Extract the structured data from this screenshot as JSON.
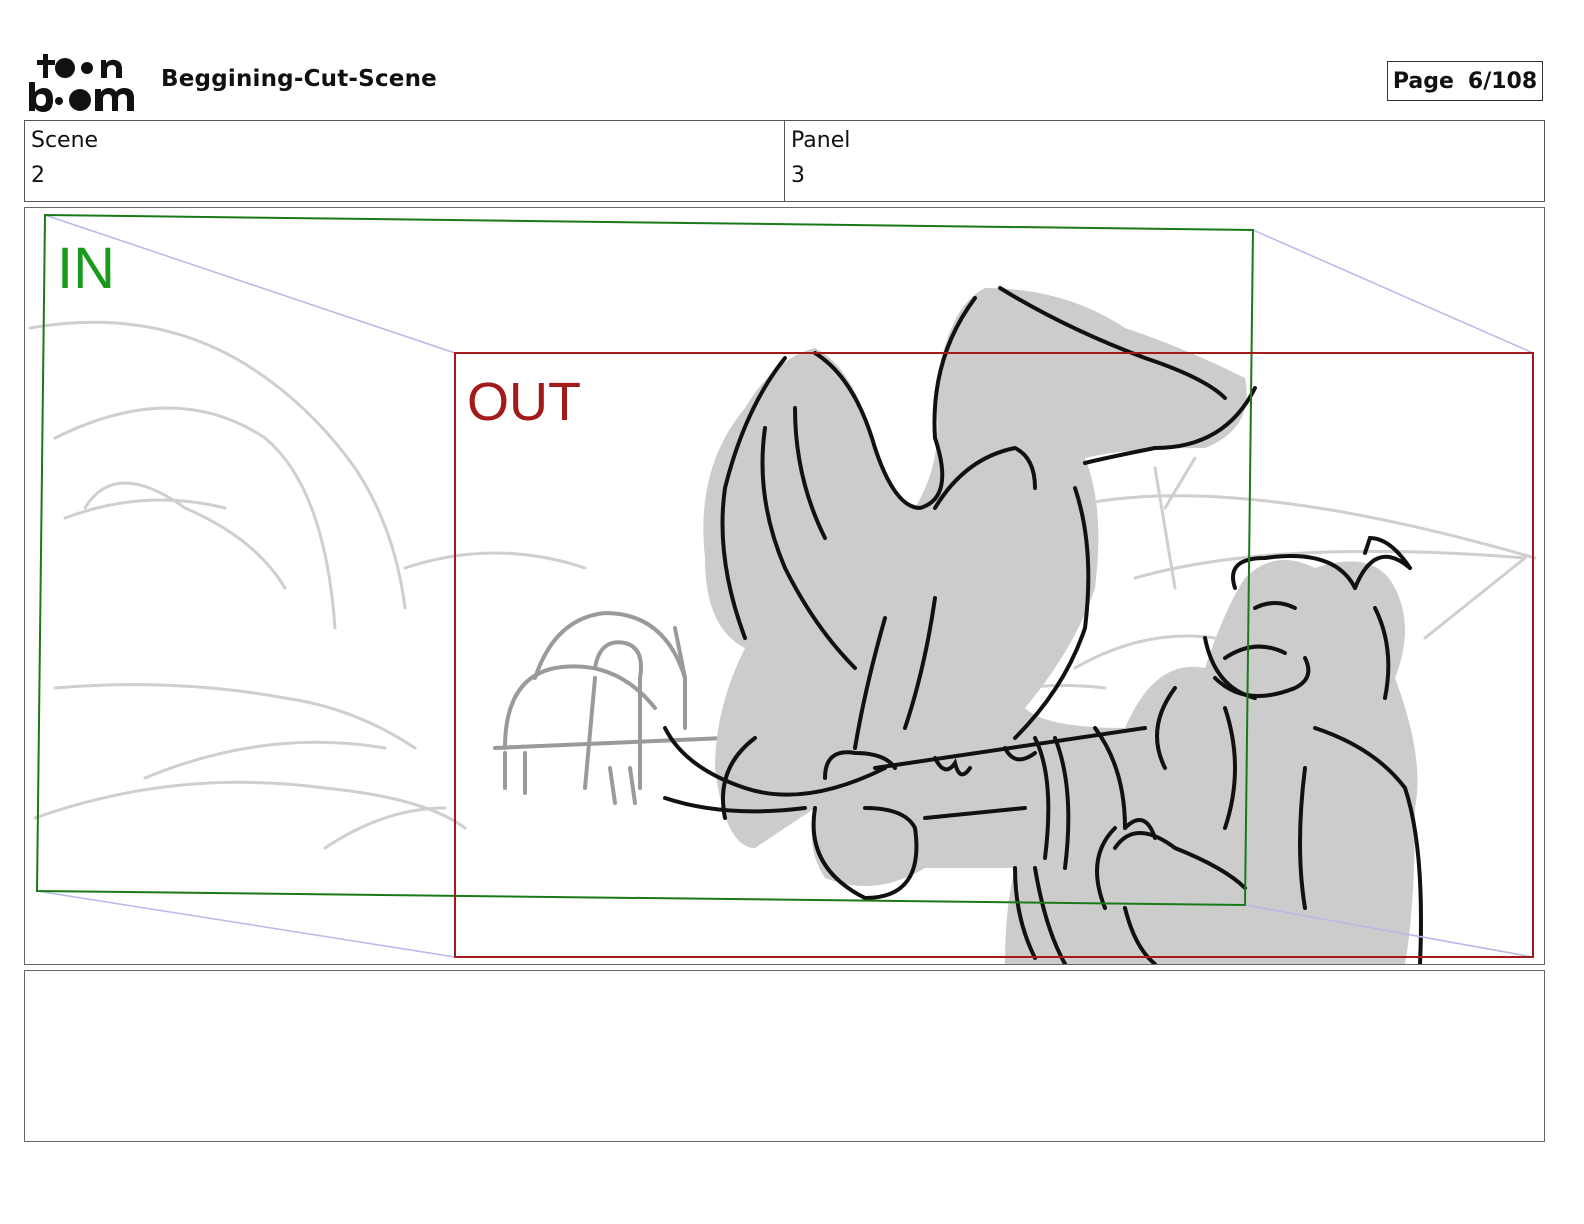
{
  "header": {
    "logo_text": "toon boom",
    "document_title": "Beggining-Cut-Scene",
    "page_label": "Page",
    "page_number": "6/108"
  },
  "info": {
    "scene_label": "Scene",
    "scene_value": "2",
    "panel_label": "Panel",
    "panel_value": "3"
  },
  "camera": {
    "in_label": "IN",
    "out_label": "OUT",
    "in_color": "#1a7a1a",
    "out_color": "#a31a1a"
  },
  "notes": {
    "text": ""
  }
}
